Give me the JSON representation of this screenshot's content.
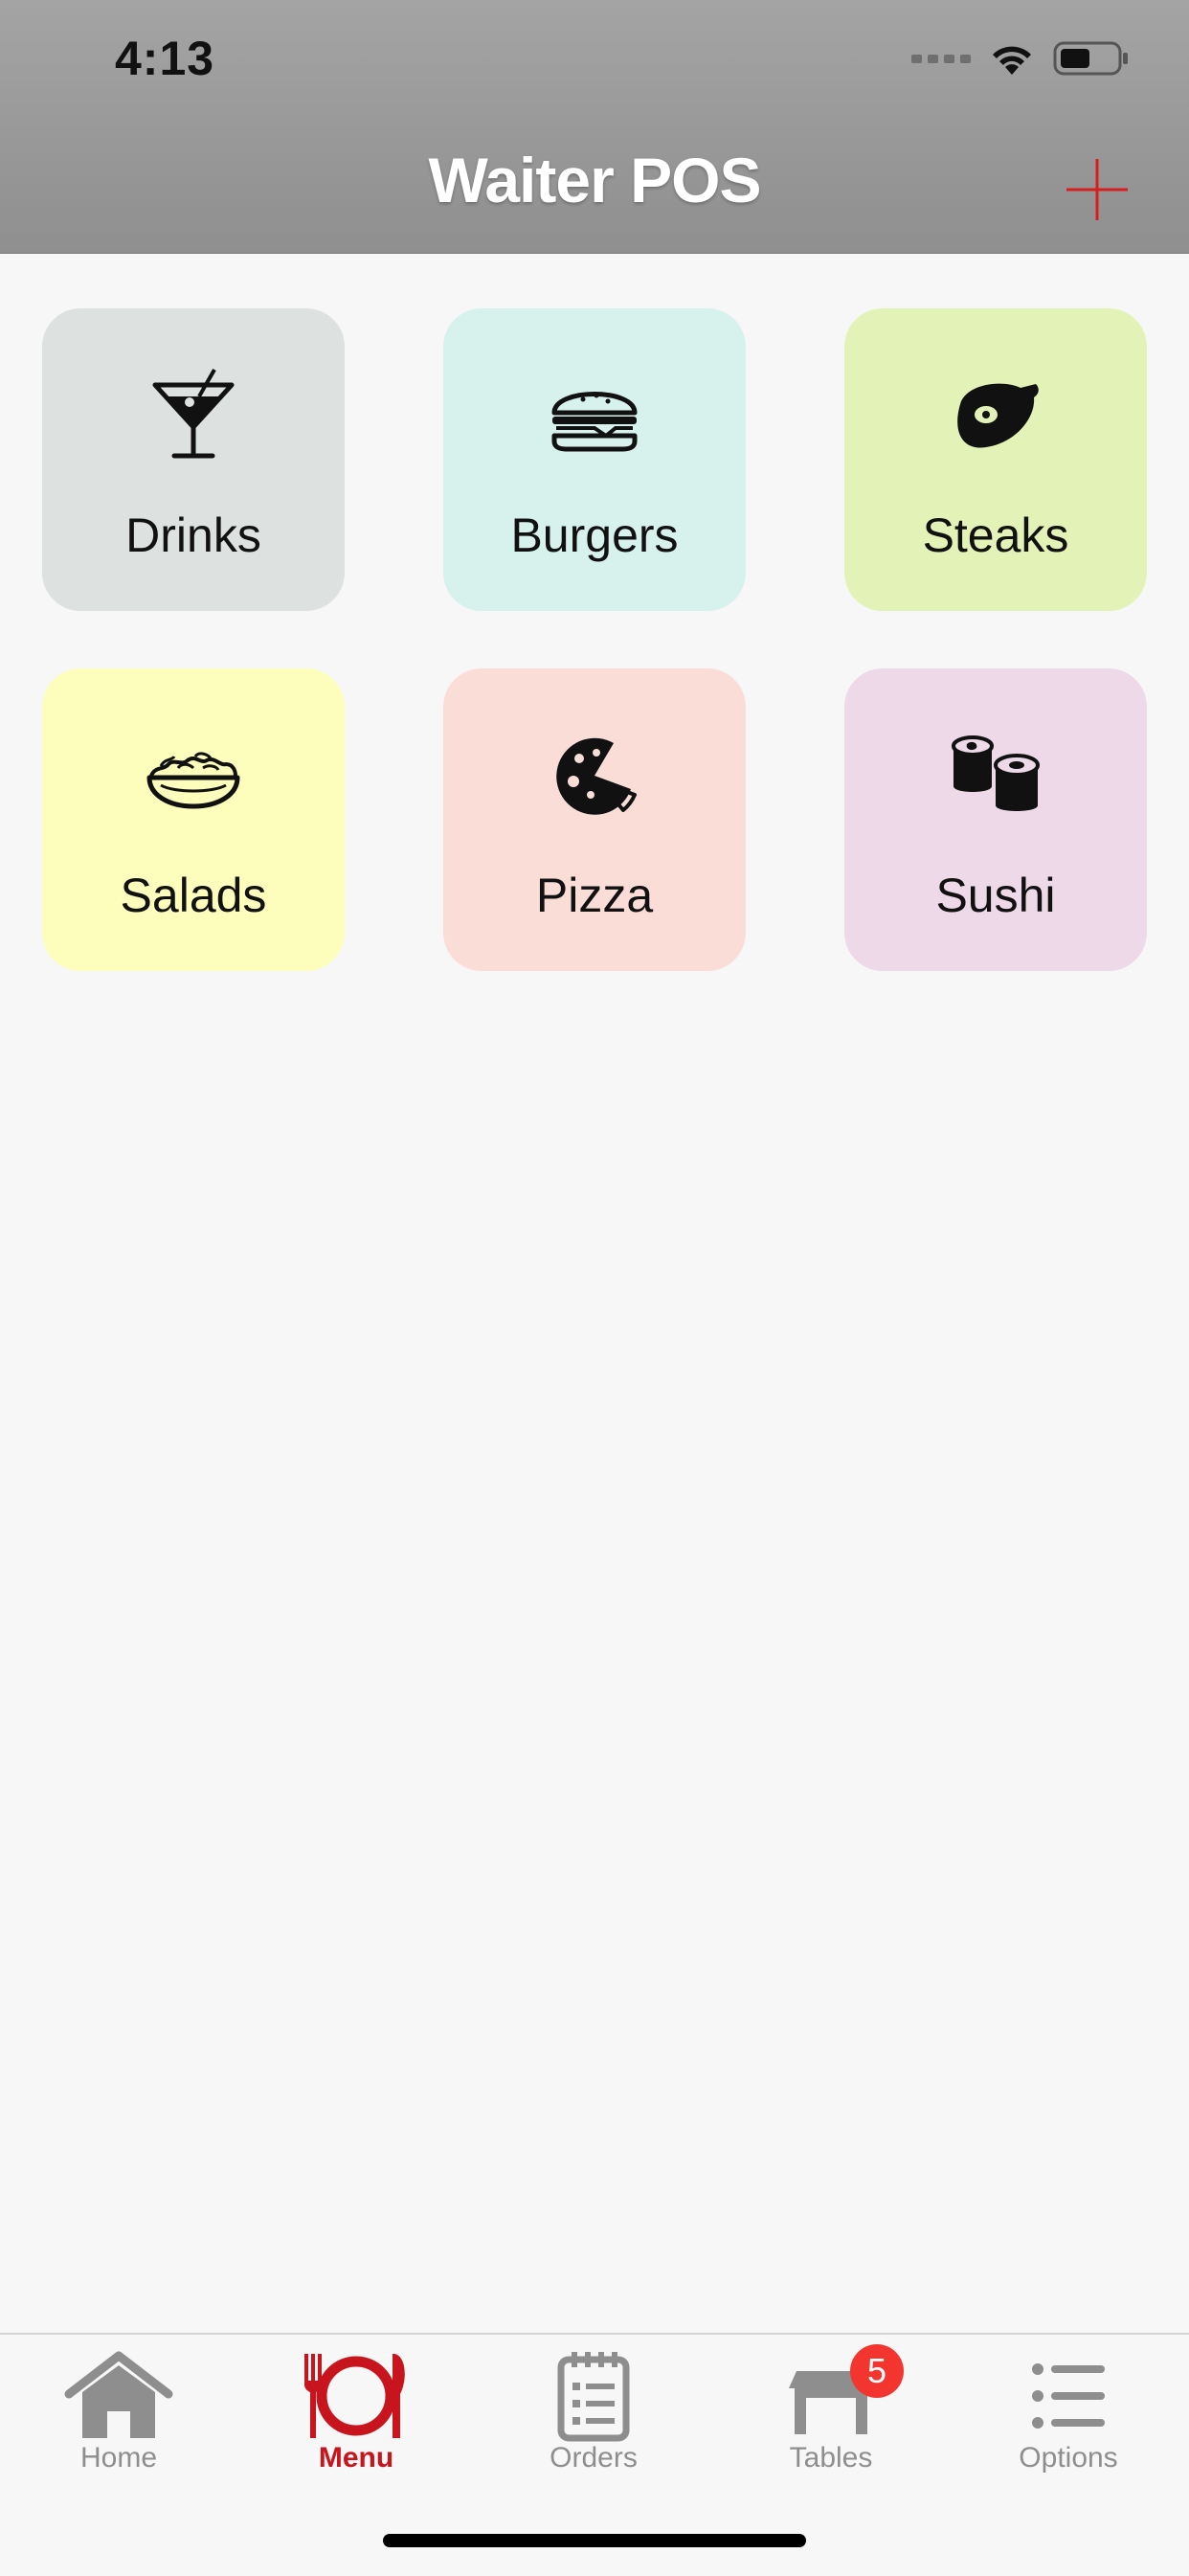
{
  "status_bar": {
    "time": "4:13",
    "icons": [
      "signal-icon",
      "wifi-icon",
      "battery-icon"
    ]
  },
  "header": {
    "title": "Waiter POS",
    "add_icon": "plus-icon"
  },
  "categories": [
    {
      "label": "Drinks",
      "icon": "cocktail-icon",
      "color": "#dde2e0"
    },
    {
      "label": "Burgers",
      "icon": "burger-icon",
      "color": "#d7f1ec"
    },
    {
      "label": "Steaks",
      "icon": "steak-icon",
      "color": "#e3f2b6"
    },
    {
      "label": "Salads",
      "icon": "salad-icon",
      "color": "#fdfdbc"
    },
    {
      "label": "Pizza",
      "icon": "pizza-icon",
      "color": "#fbddd8"
    },
    {
      "label": "Sushi",
      "icon": "sushi-icon",
      "color": "#eed9e9"
    }
  ],
  "tabbar": {
    "items": [
      {
        "label": "Home",
        "icon": "home-icon",
        "active": false
      },
      {
        "label": "Menu",
        "icon": "plate-cutlery-icon",
        "active": true
      },
      {
        "label": "Orders",
        "icon": "clipboard-icon",
        "active": false
      },
      {
        "label": "Tables",
        "icon": "table-icon",
        "active": false,
        "badge": "5"
      },
      {
        "label": "Options",
        "icon": "list-icon",
        "active": false
      }
    ]
  },
  "colors": {
    "accent": "#c8141c",
    "header_top": "#a4a4a4",
    "header_bottom": "#8f8f8f",
    "badge": "#f2352f",
    "inactive_tab": "#8e8e8e",
    "background": "#f7f7f7"
  }
}
